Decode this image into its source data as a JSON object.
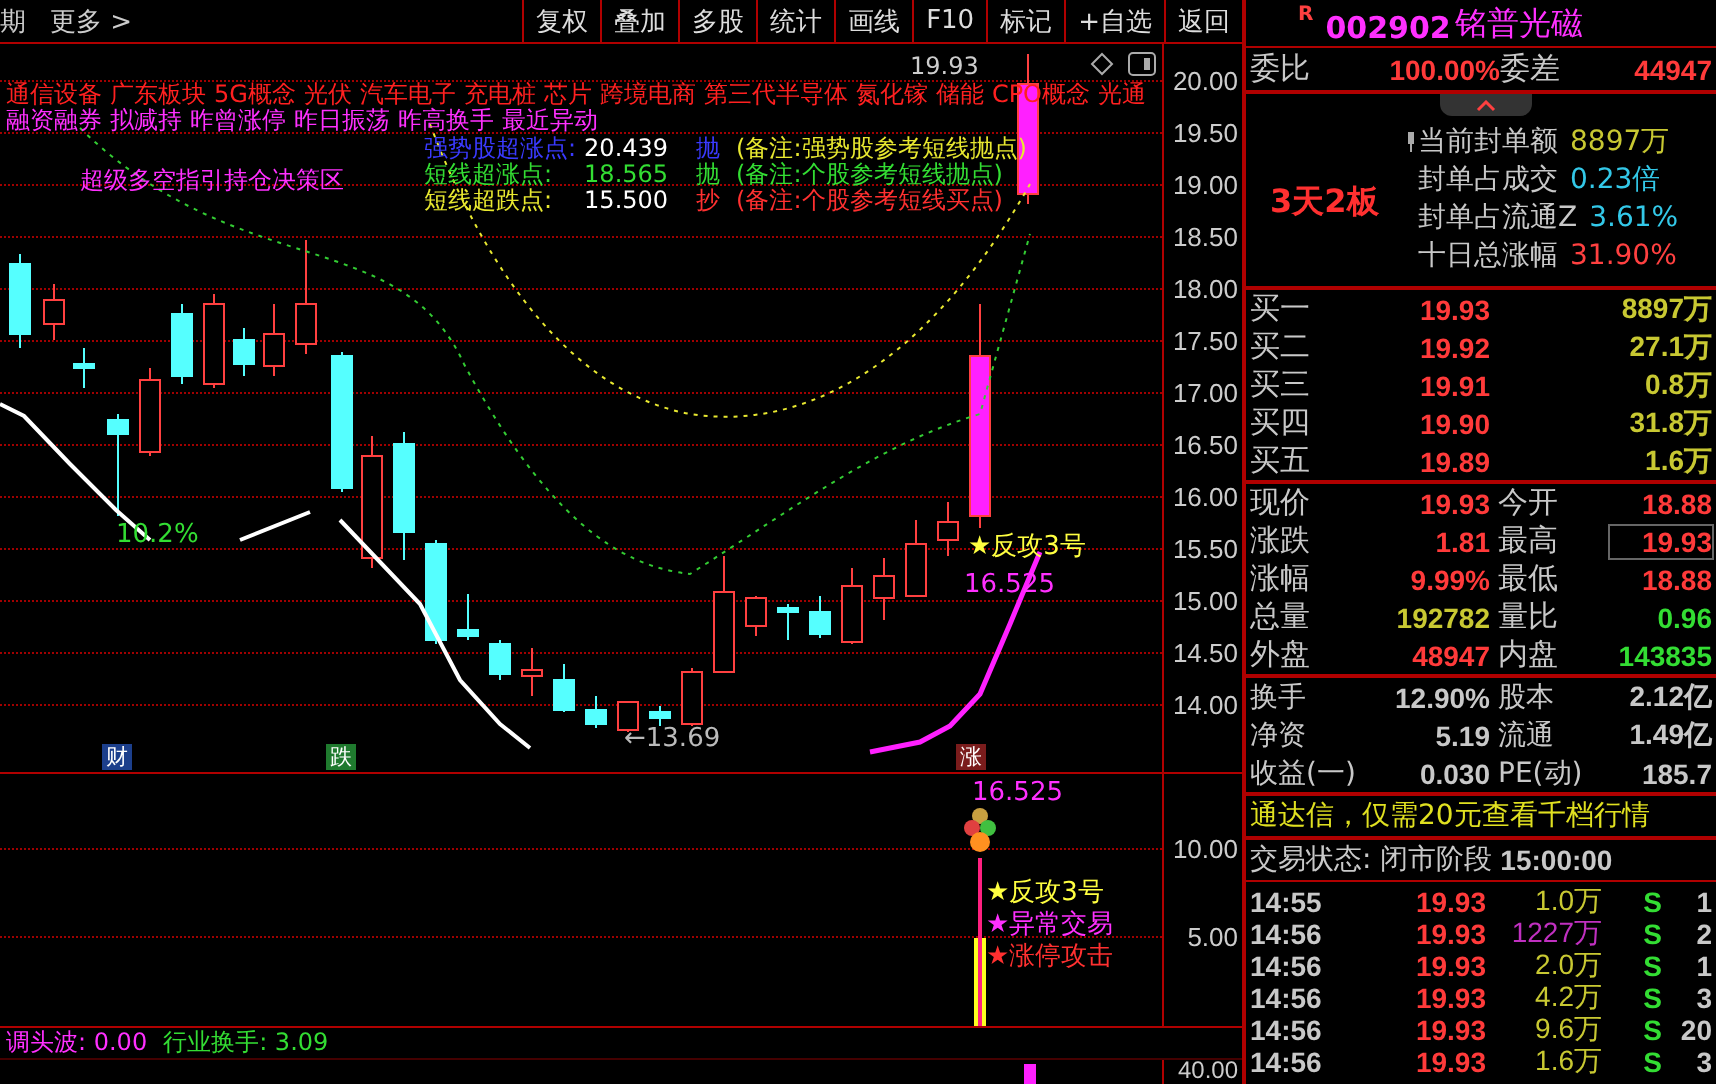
{
  "toolbar": {
    "left": [
      "期",
      "更多 >"
    ],
    "buttons": [
      "复权",
      "叠加",
      "多股",
      "统计",
      "画线",
      "F10",
      "标记",
      "+自选",
      "返回"
    ]
  },
  "main_chart": {
    "price_axis": [
      "20.00",
      "19.50",
      "19.00",
      "18.50",
      "18.00",
      "17.50",
      "17.00",
      "16.50",
      "16.00",
      "15.50",
      "15.00",
      "14.50",
      "14.00"
    ],
    "concept_tags": [
      "通信设备",
      "广东板块",
      "5G概念",
      "光伏",
      "汽车电子",
      "充电桩",
      "芯片",
      "跨境电商",
      "第三代半导体",
      "氮化镓",
      "储能",
      "CPO概念",
      "光通"
    ],
    "flag_tags": [
      "融资融券",
      "拟减持",
      "昨曾涨停",
      "昨日振荡",
      "昨高换手",
      "最近异动"
    ],
    "zone_label": "超级多空指引持仓决策区",
    "levels": [
      {
        "name": "强势股超涨点:",
        "value": "20.439",
        "action": "抛",
        "note": "(备注:强势股参考短线抛点)"
      },
      {
        "name": "短线超涨点:",
        "value": "18.565",
        "action": "抛",
        "note": "(备注:个股参考短线抛点)"
      },
      {
        "name": "短线超跌点:",
        "value": "15.500",
        "action": "抄",
        "note": "(备注:个股参考短线买点)"
      }
    ],
    "high_label": "19.93",
    "low_label": "←13.69",
    "pct_label": "10.2%",
    "signal": "★反攻3号",
    "signal_value": "16.525",
    "markers": [
      {
        "label": "财",
        "color": "#1c3f8c"
      },
      {
        "label": "跌",
        "color": "#1f7a2e"
      },
      {
        "label": "涨",
        "color": "#7a1c1c"
      }
    ]
  },
  "indicator": {
    "axis": [
      "10.00",
      "5.00"
    ],
    "value": "16.525",
    "signals": [
      "★反攻3号",
      "★异常交易",
      "★涨停攻击"
    ],
    "readouts": [
      "调头波: 0.00",
      "行业换手: 3.09"
    ],
    "lower_axis": "40.00"
  },
  "quote": {
    "badge": "R",
    "code": "002902",
    "name": "铭普光磁",
    "ratio": {
      "label": "委比",
      "value": "100.00%",
      "label2": "委差",
      "value2": "44947"
    },
    "streak": "3天2板",
    "seal_info": [
      {
        "label": "当前封单额",
        "value": "8897万",
        "color": "#c8c832"
      },
      {
        "label": "封单占成交",
        "value": "0.23倍",
        "color": "#33c8e8"
      },
      {
        "label": "封单占流通Z",
        "value": "3.61%",
        "color": "#33c8e8"
      },
      {
        "label": "十日总涨幅",
        "value": "31.90%",
        "color": "#ff4040"
      }
    ],
    "bids": [
      {
        "label": "买一",
        "price": "19.93",
        "volume": "8897万"
      },
      {
        "label": "买二",
        "price": "19.92",
        "volume": "27.1万"
      },
      {
        "label": "买三",
        "price": "19.91",
        "volume": "0.8万"
      },
      {
        "label": "买四",
        "price": "19.90",
        "volume": "31.8万"
      },
      {
        "label": "买五",
        "price": "19.89",
        "volume": "1.6万"
      }
    ],
    "stats": [
      {
        "label": "现价",
        "value": "19.93",
        "color": "#ff3a3a",
        "boxed": false
      },
      {
        "label": "今开",
        "value": "18.88",
        "color": "#ff3a3a",
        "boxed": false
      },
      {
        "label": "涨跌",
        "value": "1.81",
        "color": "#ff3a3a",
        "boxed": false
      },
      {
        "label": "最高",
        "value": "19.93",
        "color": "#ff3a3a",
        "boxed": true
      },
      {
        "label": "涨幅",
        "value": "9.99%",
        "color": "#ff3a3a",
        "boxed": false
      },
      {
        "label": "最低",
        "value": "18.88",
        "color": "#ff3a3a",
        "boxed": false
      },
      {
        "label": "总量",
        "value": "192782",
        "color": "#c8c832",
        "boxed": false
      },
      {
        "label": "量比",
        "value": "0.96",
        "color": "#33dd33",
        "boxed": false
      },
      {
        "label": "外盘",
        "value": "48947",
        "color": "#ff3a3a",
        "boxed": false
      },
      {
        "label": "内盘",
        "value": "143835",
        "color": "#33dd33",
        "boxed": false
      }
    ],
    "fundamentals": [
      {
        "label": "换手",
        "value": "12.90%",
        "label2": "股本",
        "value2": "2.12亿"
      },
      {
        "label": "净资",
        "value": "5.19",
        "label2": "流通",
        "value2": "1.49亿"
      },
      {
        "label": "收益(一)",
        "value": "0.030",
        "label2": "PE(动)",
        "value2": "185.7"
      }
    ],
    "promo": "通达信，仅需20元查看千档行情",
    "status": {
      "label": "交易状态: 闭市阶段",
      "time": "15:00:00"
    },
    "trades": [
      {
        "time": "14:55",
        "price": "19.93",
        "volume": "1.0万",
        "color": "#c8c832",
        "side": "S",
        "count": "1"
      },
      {
        "time": "14:56",
        "price": "19.93",
        "volume": "1227万",
        "color": "#c030c0",
        "side": "S",
        "count": "2"
      },
      {
        "time": "14:56",
        "price": "19.93",
        "volume": "2.0万",
        "color": "#c8c832",
        "side": "S",
        "count": "1"
      },
      {
        "time": "14:56",
        "price": "19.93",
        "volume": "4.2万",
        "color": "#c8c832",
        "side": "S",
        "count": "3"
      },
      {
        "time": "14:56",
        "price": "19.93",
        "volume": "9.6万",
        "color": "#c8c832",
        "side": "S",
        "count": "20"
      },
      {
        "time": "14:56",
        "price": "19.93",
        "volume": "1.6万",
        "color": "#c8c832",
        "side": "S",
        "count": "3"
      }
    ]
  }
}
